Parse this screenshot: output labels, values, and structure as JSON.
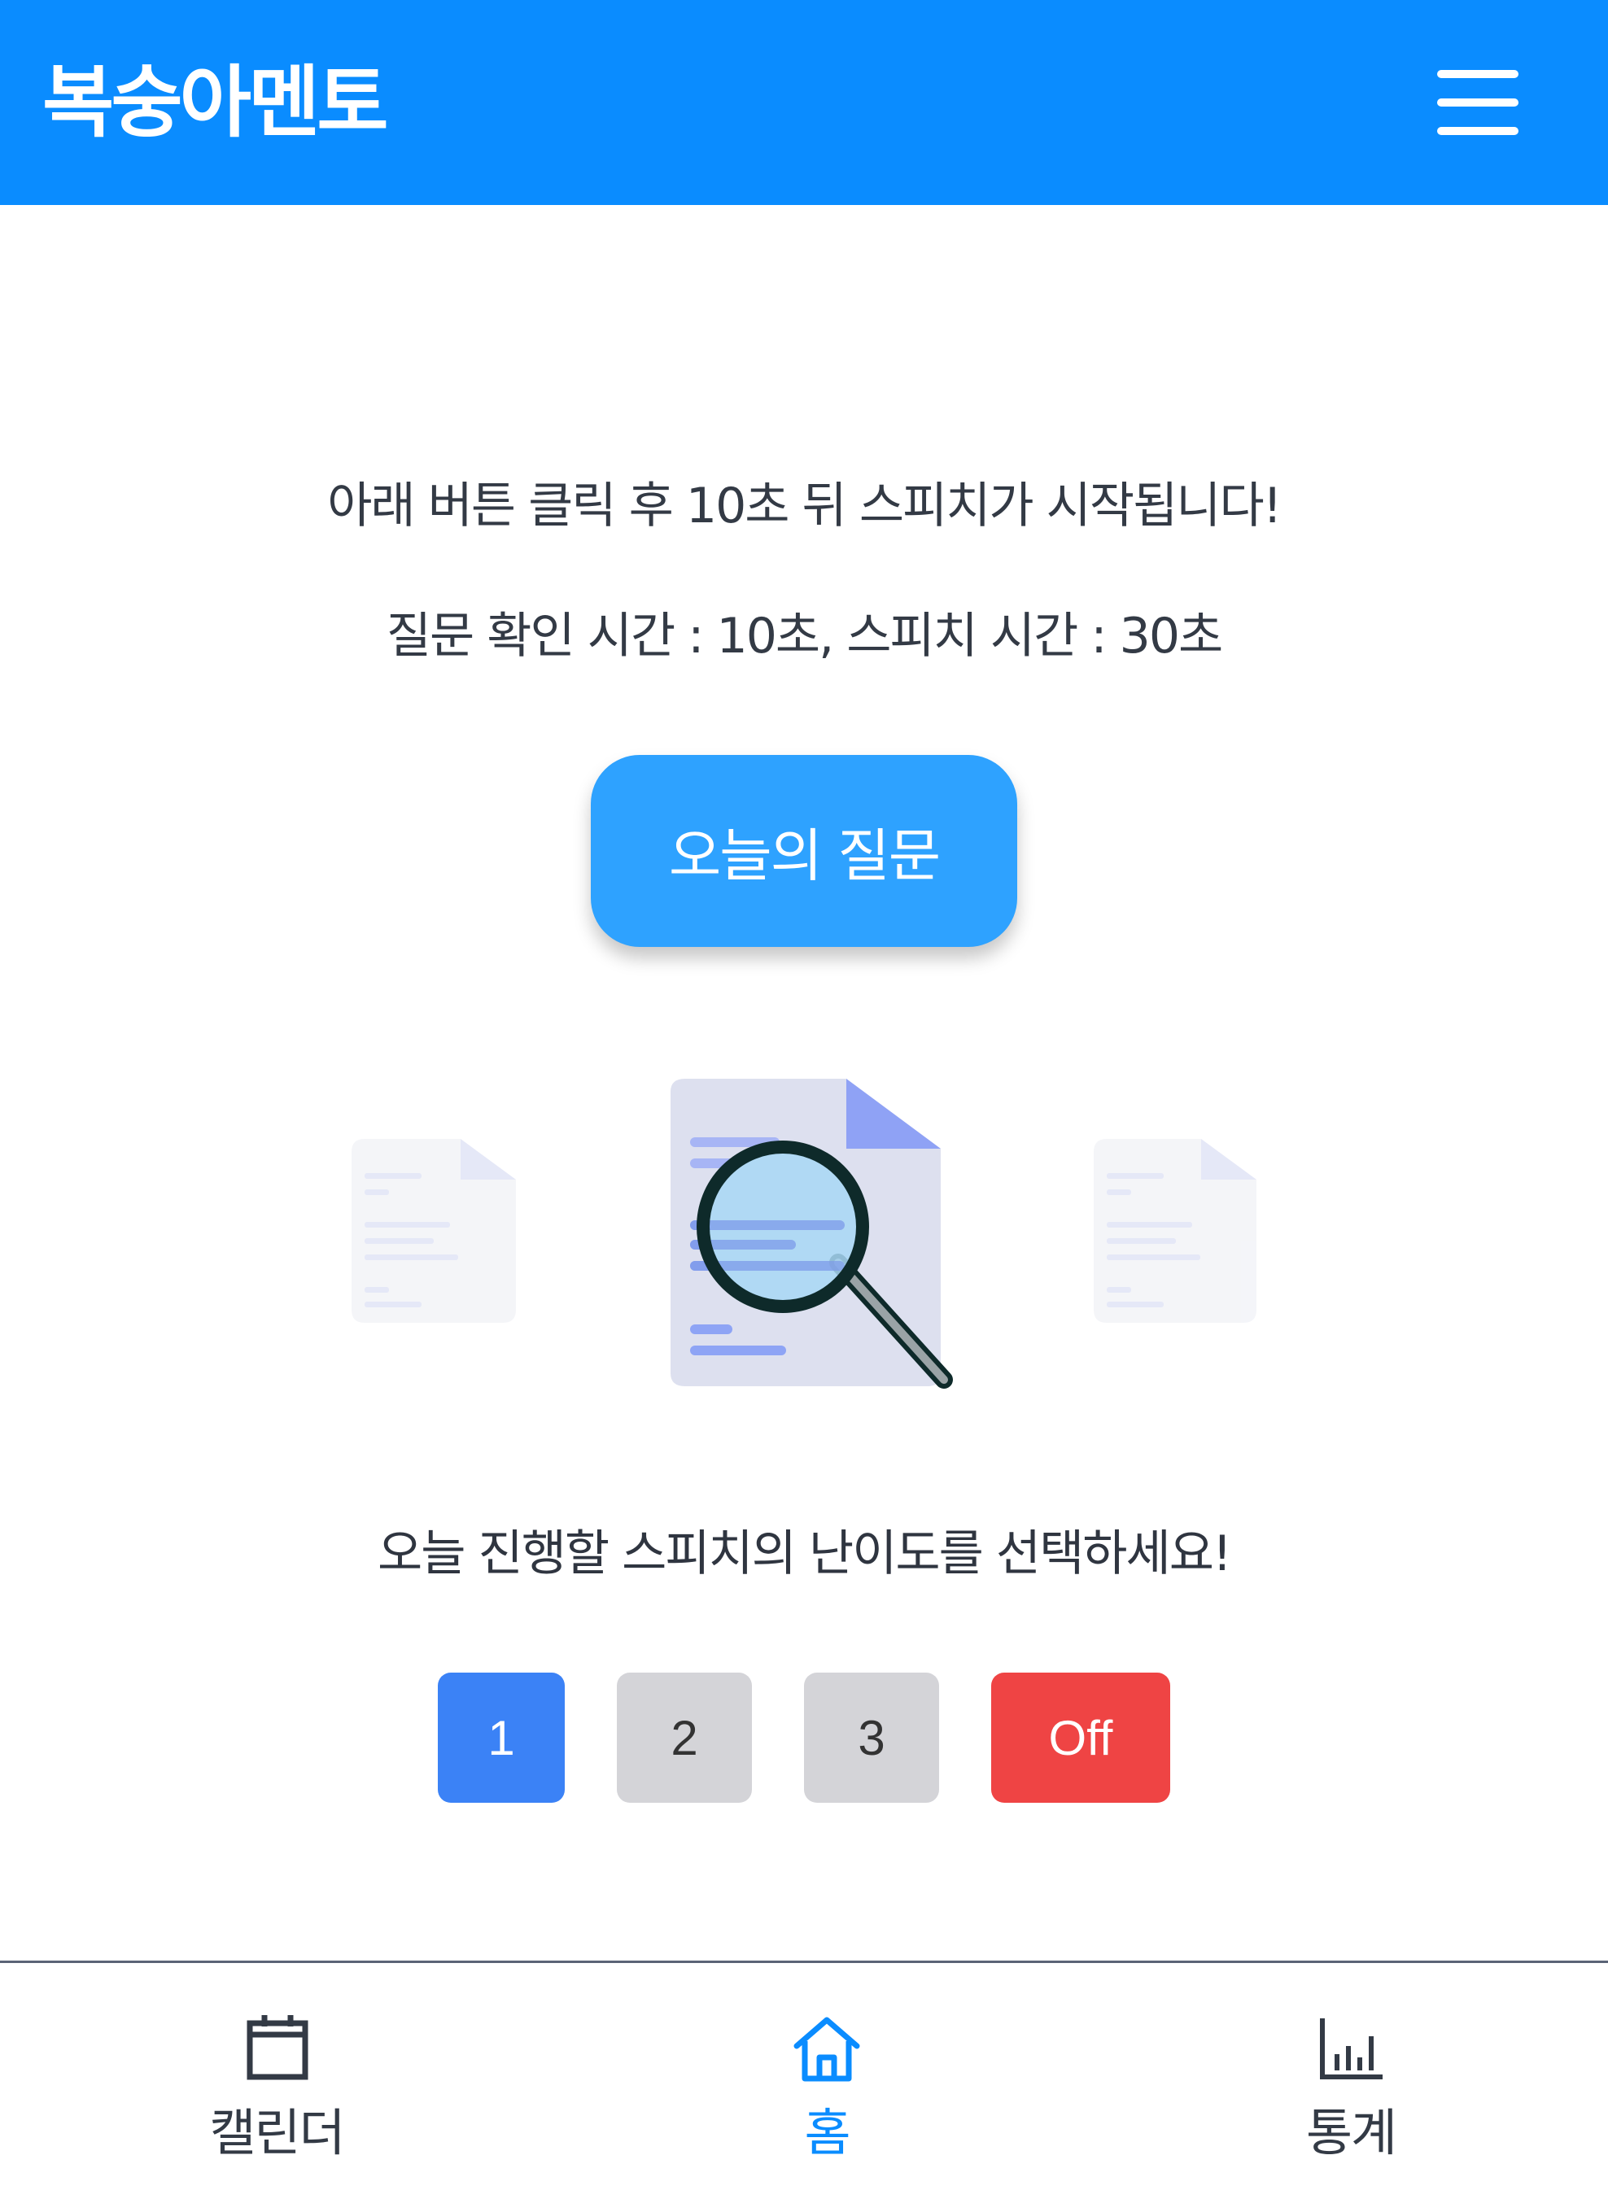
{
  "header": {
    "title": "복숭아멘토",
    "menu_icon": "hamburger-menu-icon"
  },
  "main": {
    "instruction_line1": "아래 버튼 클릭 후 10초 뒤 스피치가 시작됩니다!",
    "instruction_line2": "질문 확인 시간 : 10초, 스피치 시간 : 30초",
    "question_button_label": "오늘의 질문",
    "illustration_icon": "document-search-icon",
    "difficulty_prompt": "오늘 진행할 스피치의 난이도를 선택하세요!",
    "difficulty_levels": [
      {
        "label": "1",
        "selected": true,
        "color": "#3b82f6"
      },
      {
        "label": "2",
        "selected": false,
        "color": "#d4d4d8"
      },
      {
        "label": "3",
        "selected": false,
        "color": "#d4d4d8"
      },
      {
        "label": "Off",
        "selected": false,
        "color": "#ef4444"
      }
    ]
  },
  "bottom_nav": {
    "items": [
      {
        "label": "캘린더",
        "icon": "calendar-icon",
        "active": false
      },
      {
        "label": "홈",
        "icon": "home-icon",
        "active": true
      },
      {
        "label": "통계",
        "icon": "bar-chart-icon",
        "active": false
      }
    ]
  },
  "colors": {
    "brand": "#0a8cff",
    "button": "#2ea2ff",
    "selected_level": "#3b82f6",
    "off": "#ef4444",
    "inactive_level": "#d4d4d8"
  }
}
